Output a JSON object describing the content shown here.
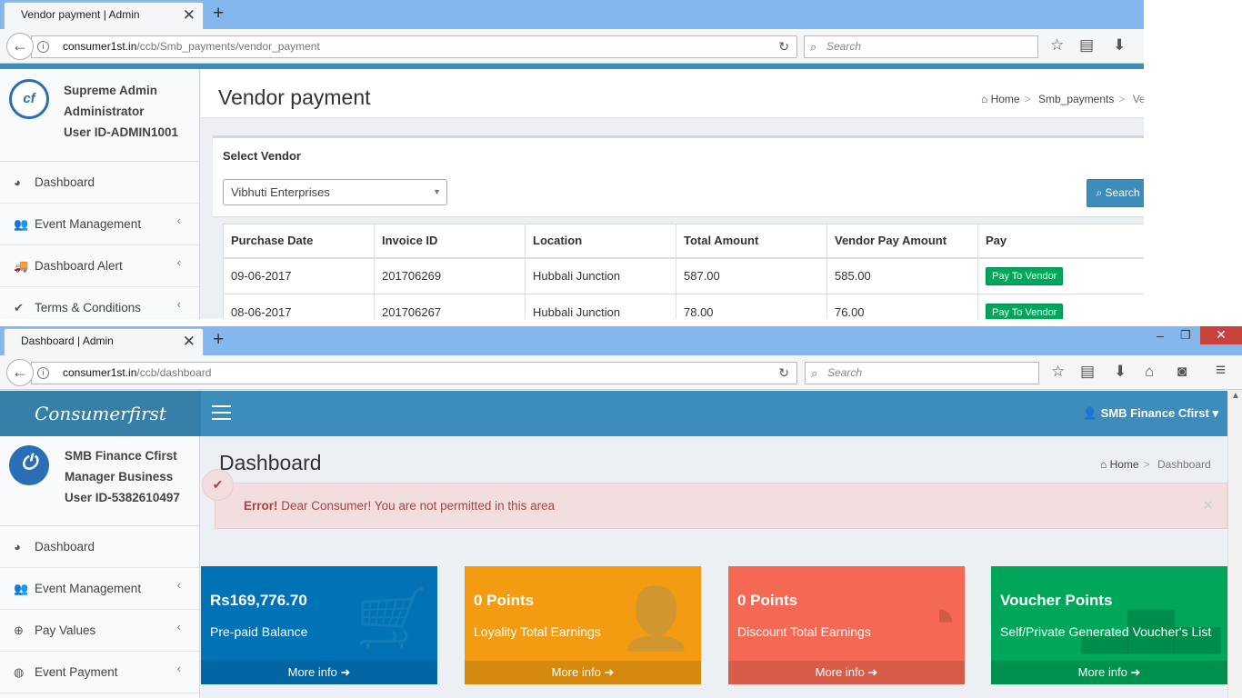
{
  "window1": {
    "tab_title": "Vendor payment | Admin",
    "url_host": "consumer1st.in",
    "url_path": "/ccb/Smb_payments/vendor_payment",
    "search_placeholder": "Search",
    "user": {
      "name": "Supreme Admin",
      "role": "Administrator",
      "id": "User ID-ADMIN1001"
    },
    "menu": [
      {
        "label": "Dashboard",
        "icon": "dashboard-icon"
      },
      {
        "label": "Event Management",
        "icon": "users-icon"
      },
      {
        "label": "Dashboard Alert",
        "icon": "truck-icon"
      },
      {
        "label": "Terms & Conditions",
        "icon": "check-icon"
      }
    ],
    "page_title": "Vendor payment",
    "breadcrumb": [
      "Home",
      "Smb_payments",
      "Ve"
    ],
    "select_vendor_label": "Select Vendor",
    "selected_vendor": "Vibhuti Enterprises",
    "search_button": "Search",
    "table": {
      "headers": [
        "Purchase Date",
        "Invoice ID",
        "Location",
        "Total Amount",
        "Vendor Pay Amount",
        "Pay"
      ],
      "rows": [
        [
          "09-06-2017",
          "201706269",
          "Hubbali Junction",
          "587.00",
          "585.00",
          "Pay To Vendor"
        ],
        [
          "08-06-2017",
          "201706267",
          "Hubbali Junction",
          "78.00",
          "76.00",
          "Pay To Vendor"
        ]
      ]
    }
  },
  "window2": {
    "tab_title": "Dashboard | Admin",
    "url_host": "consumer1st.in",
    "url_path": "/ccb/dashboard",
    "search_placeholder": "Search",
    "brand": "Consumerfirst",
    "header_user": "SMB Finance Cfirst",
    "user": {
      "name": "SMB Finance Cfirst",
      "role": "Manager Business",
      "id": "User ID-5382610497"
    },
    "menu": [
      {
        "label": "Dashboard",
        "icon": "dashboard-icon"
      },
      {
        "label": "Event Management",
        "icon": "users-icon"
      },
      {
        "label": "Pay Values",
        "icon": "lifebuoy-icon"
      },
      {
        "label": "Event Payment",
        "icon": "globe-icon"
      }
    ],
    "page_title": "Dashboard",
    "breadcrumb": [
      "Home",
      "Dashboard"
    ],
    "alert_strong": "Error!",
    "alert_text": " Dear Consumer! You are not permitted in this area",
    "boxes": [
      {
        "value": "Rs169,776.70",
        "label": "Pre-paid Balance",
        "link": "More info",
        "color": "#0073b7"
      },
      {
        "value": "0 Points",
        "label": "Loyality Total Earnings",
        "link": "More info",
        "color": "#f39c12"
      },
      {
        "value": "0 Points",
        "label": "Discount Total Earnings",
        "link": "More info",
        "color": "#f56954"
      },
      {
        "value": "Voucher Points",
        "label": "Self/Private Generated Voucher's List",
        "link": "More info",
        "color": "#00a65a"
      }
    ]
  }
}
